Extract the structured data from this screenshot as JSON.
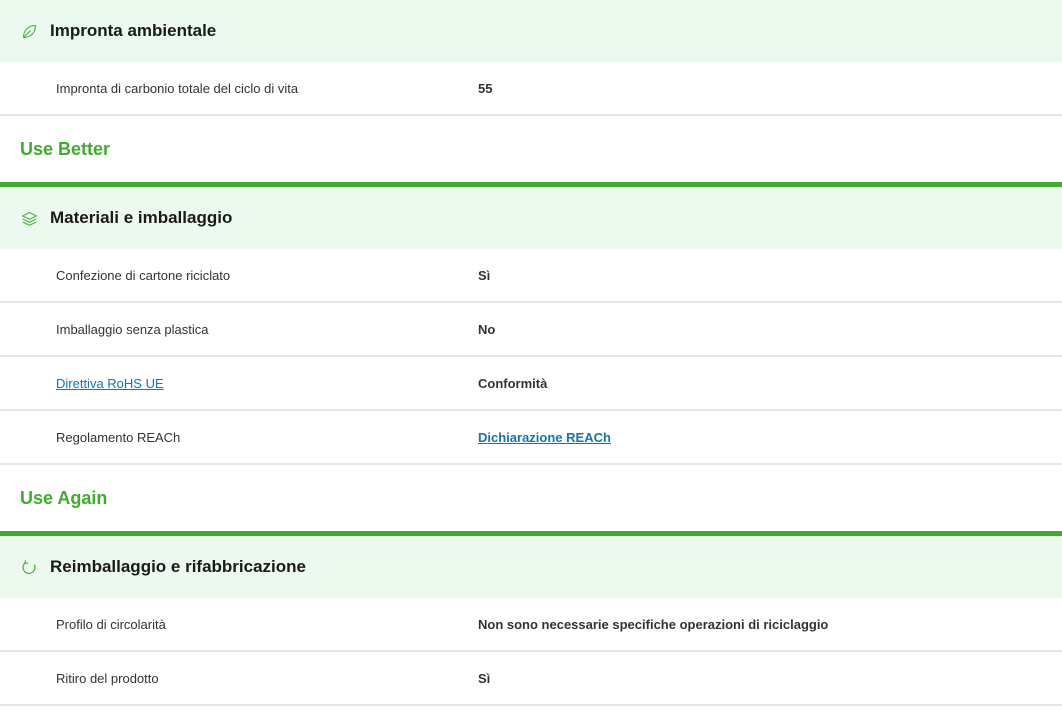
{
  "sections": [
    {
      "icon": "leaf-icon",
      "title": "Impronta ambientale",
      "rows": [
        {
          "label": "Impronta di carbonio totale del ciclo di vita",
          "value": "55"
        }
      ]
    },
    {
      "group": "Use Better",
      "icon": "layers-icon",
      "title": "Materiali e imballaggio",
      "rows": [
        {
          "label": "Confezione di cartone riciclato",
          "value": "Sì"
        },
        {
          "label": "Imballaggio senza plastica",
          "value": "No"
        },
        {
          "label": "Direttiva RoHS UE",
          "value": "Conformità"
        },
        {
          "label": "Regolamento REACh",
          "value": "Dichiarazione REACh"
        }
      ]
    },
    {
      "group": "Use Again",
      "icon": "refresh-icon",
      "title": "Reimballaggio e rifabbricazione",
      "rows": [
        {
          "label": "Profilo di circolarità",
          "value": "Non sono necessarie specifiche operazioni di riciclaggio"
        },
        {
          "label": "Ritiro del prodotto",
          "value": "Sì"
        }
      ]
    }
  ],
  "colors": {
    "accent_green": "#3dae2b",
    "header_bg": "#ebf9ee",
    "link_blue": "#0f76b8"
  }
}
